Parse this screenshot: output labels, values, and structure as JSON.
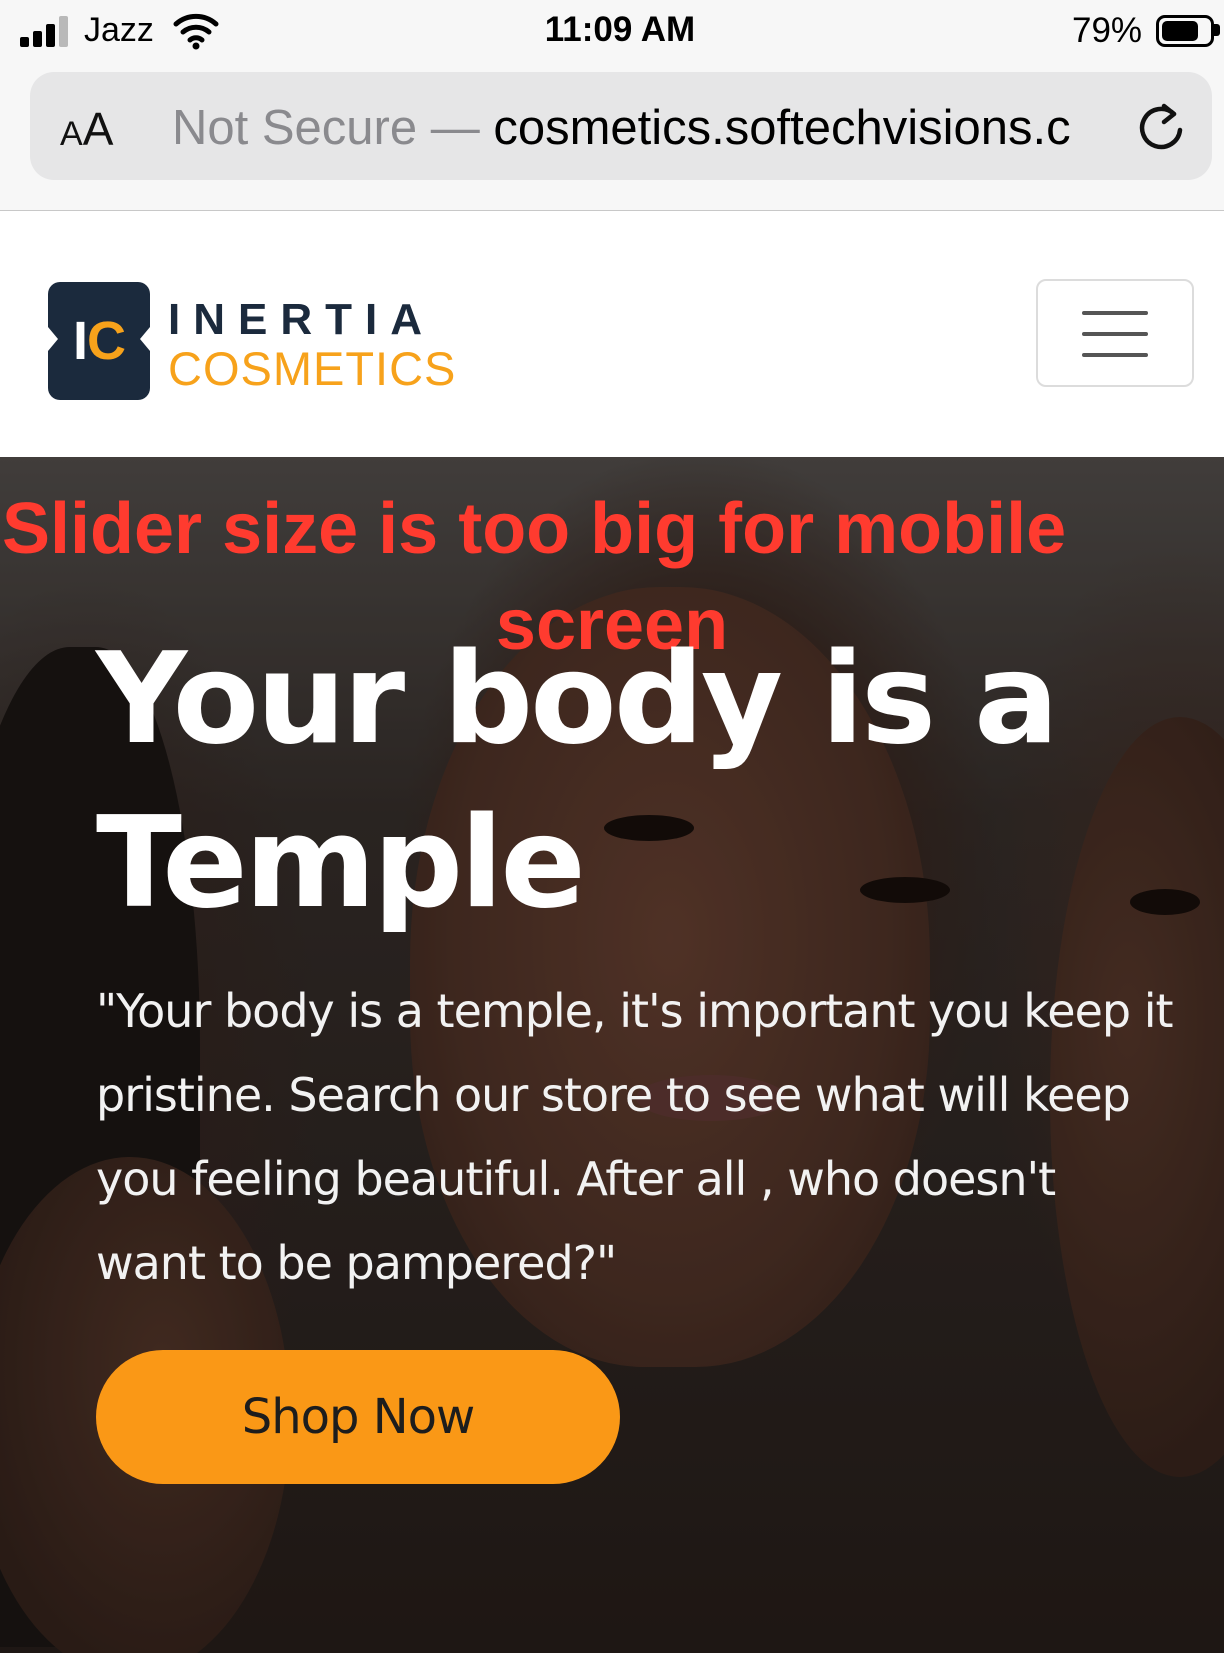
{
  "status_bar": {
    "carrier": "Jazz",
    "time": "11:09 AM",
    "battery_percent": "79%",
    "battery_level": 0.79
  },
  "browser": {
    "aa_small": "A",
    "aa_big": "A",
    "not_secure": "Not Secure —",
    "url": " cosmetics.softechvisions.c"
  },
  "header": {
    "logo_letters_i": "I",
    "logo_letters_c": "C",
    "brand_line1": "INERTIA",
    "brand_line2": "COSMETICS"
  },
  "annotation": {
    "line1": "Slider size is too big for mobile",
    "line2": "screen"
  },
  "hero": {
    "title_line1": "Your body is a",
    "title_line2": "Temple",
    "text": "\"Your body is a temple, it's important you keep it pristine. Search our store to see what will keep you feeling beautiful. After all , who doesn't want to be pampered?\"",
    "button_label": "Shop Now"
  },
  "colors": {
    "brand_navy": "#1b2a3d",
    "brand_orange": "#f7a21b",
    "button_orange": "#fa9816",
    "annotation_red": "#ff3b2f"
  }
}
